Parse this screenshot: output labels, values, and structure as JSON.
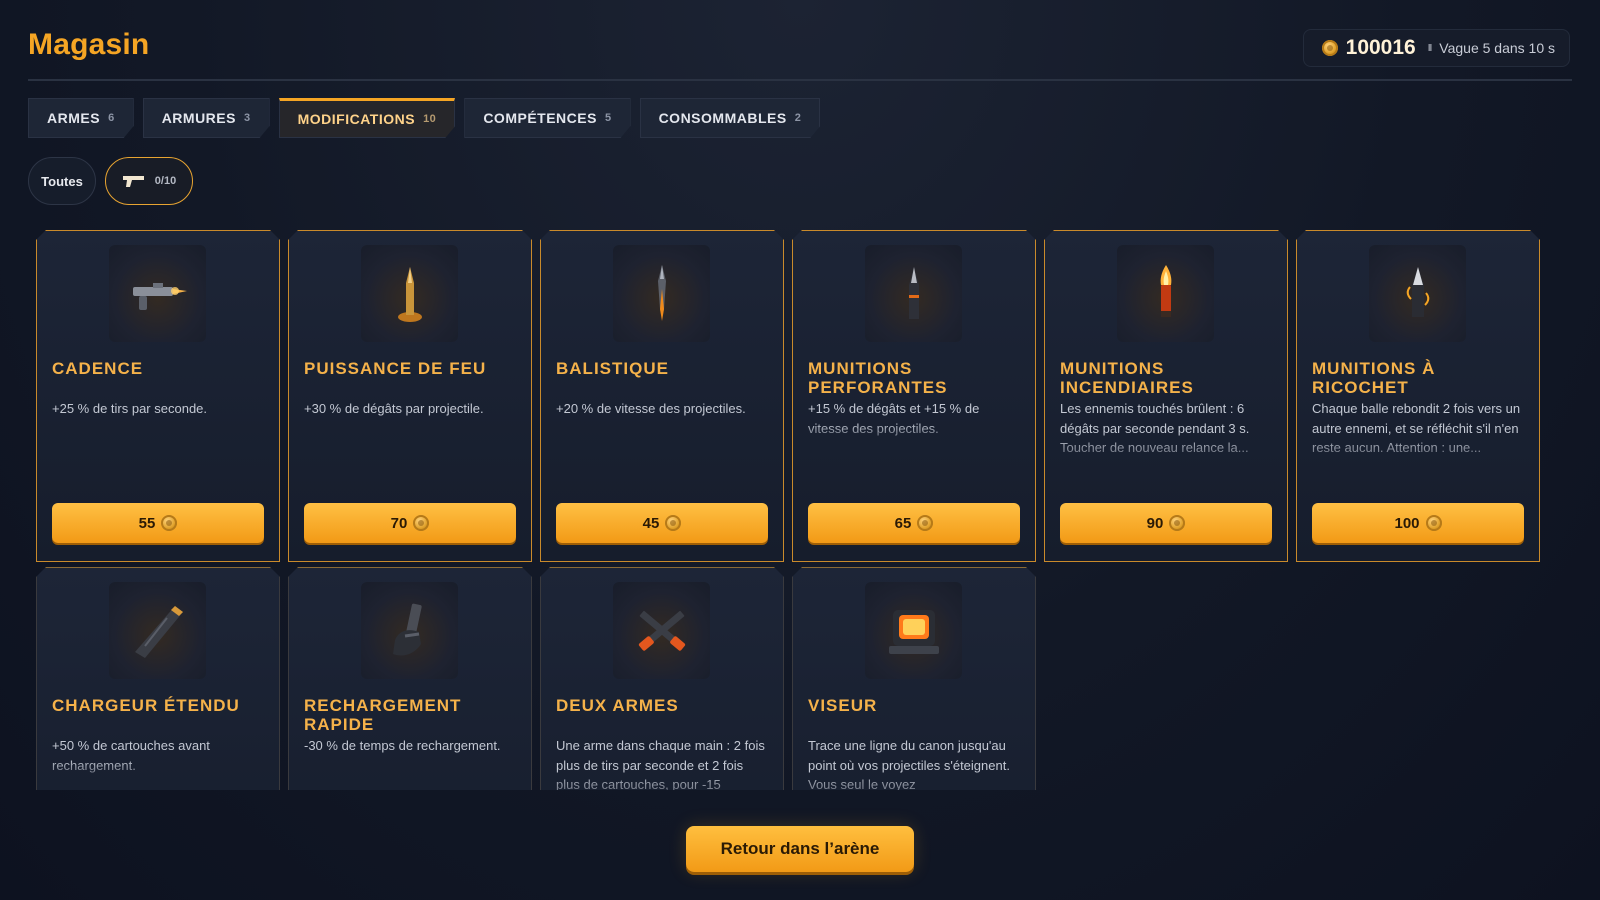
{
  "header": {
    "title": "Magasin",
    "coins": "100016",
    "pause_glyph": "II",
    "wave_status": "Vague 5 dans 10 s"
  },
  "tabs": [
    {
      "label": "ARMES",
      "count": "6",
      "active": false
    },
    {
      "label": "ARMURES",
      "count": "3",
      "active": false
    },
    {
      "label": "MODIFICATIONS",
      "count": "10",
      "active": true
    },
    {
      "label": "COMPÉTENCES",
      "count": "5",
      "active": false
    },
    {
      "label": "CONSOMMABLES",
      "count": "2",
      "active": false
    }
  ],
  "filters": {
    "all_label": "Toutes",
    "weapon_icon": "pistol-icon",
    "weapon_ratio": "0/10"
  },
  "items": [
    {
      "name": "CADENCE",
      "desc": "+25 % de tirs par seconde.",
      "price": "55",
      "icon": "rapid-gun-icon"
    },
    {
      "name": "PUISSANCE DE FEU",
      "desc": "+30 % de dégâts par projectile.",
      "price": "70",
      "icon": "glowing-bullet-icon"
    },
    {
      "name": "BALISTIQUE",
      "desc": "+20 % de vitesse des projectiles.",
      "price": "45",
      "icon": "dart-bullet-icon"
    },
    {
      "name": "MUNITIONS PERFORANTES",
      "desc": "+15 % de dégâts et +15 % de vitesse des projectiles.",
      "price": "65",
      "icon": "piercing-round-icon"
    },
    {
      "name": "MUNITIONS INCENDIAIRES",
      "desc": "Les ennemis touchés brûlent : 6 dégâts par seconde pendant 3 s. Toucher de nouveau relance la...",
      "price": "90",
      "icon": "incendiary-round-icon"
    },
    {
      "name": "MUNITIONS À RICOCHET",
      "desc": "Chaque balle rebondit 2 fois vers un autre ennemi, et se réfléchit s'il n'en reste aucun. Attention : une...",
      "price": "100",
      "icon": "ricochet-round-icon"
    },
    {
      "name": "CHARGEUR ÉTENDU",
      "desc": "+50 % de cartouches avant rechargement.",
      "price": "",
      "icon": "magazine-icon"
    },
    {
      "name": "RECHARGEMENT RAPIDE",
      "desc": "-30 % de temps de rechargement.",
      "price": "",
      "icon": "hand-magazine-icon"
    },
    {
      "name": "DEUX ARMES",
      "desc": "Une arme dans chaque main : 2 fois plus de tirs par seconde et 2 fois plus de cartouches, pour -15",
      "price": "",
      "icon": "crossed-guns-icon"
    },
    {
      "name": "VISEUR",
      "desc": "Trace une ligne du canon jusqu'au point où vos projectiles s'éteignent. Vous seul le voyez",
      "price": "",
      "icon": "red-dot-sight-icon"
    }
  ],
  "footer": {
    "back_label": "Retour dans l’arène"
  },
  "colors": {
    "accent": "#f5a524",
    "card_border": "#c98a2b",
    "background": "#121826"
  }
}
